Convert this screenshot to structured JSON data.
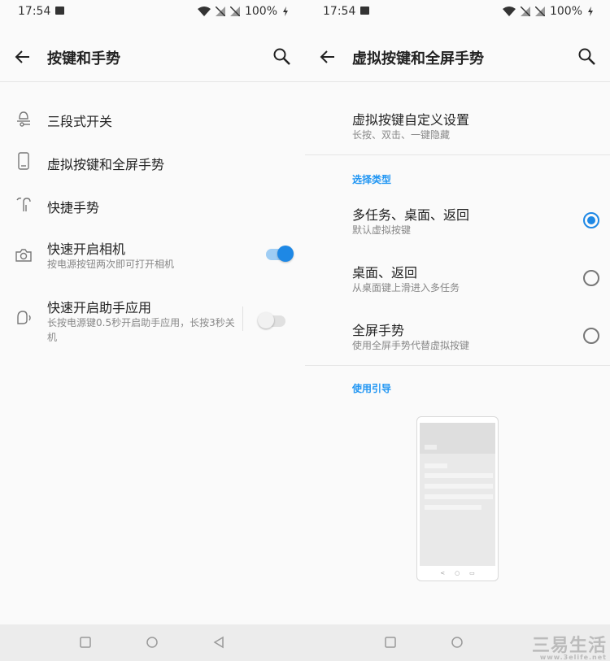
{
  "status_bar": {
    "time": "17:54",
    "battery": "100%"
  },
  "left": {
    "title": "按键和手势",
    "items": [
      {
        "title": "三段式开关"
      },
      {
        "title": "虚拟按键和全屏手势"
      },
      {
        "title": "快捷手势"
      },
      {
        "title": "快速开启相机",
        "subtitle": "按电源按钮两次即可打开相机",
        "toggle": "on"
      },
      {
        "title": "快速开启助手应用",
        "subtitle": "长按电源键0.5秒开启助手应用，长按3秒关机",
        "toggle": "off"
      }
    ]
  },
  "right": {
    "title": "虚拟按键和全屏手势",
    "custom": {
      "title": "虚拟按键自定义设置",
      "subtitle": "长按、双击、一键隐藏"
    },
    "section_type": "选择类型",
    "options": [
      {
        "title": "多任务、桌面、返回",
        "subtitle": "默认虚拟按键",
        "selected": true
      },
      {
        "title": "桌面、返回",
        "subtitle": "从桌面键上滑进入多任务",
        "selected": false
      },
      {
        "title": "全屏手势",
        "subtitle": "使用全屏手势代替虚拟按键",
        "selected": false
      }
    ],
    "section_guide": "使用引导"
  },
  "watermark": {
    "text": "三易生活",
    "url": "www.3elife.net"
  },
  "colors": {
    "accent": "#1e88e5",
    "section": "#2196f3"
  }
}
